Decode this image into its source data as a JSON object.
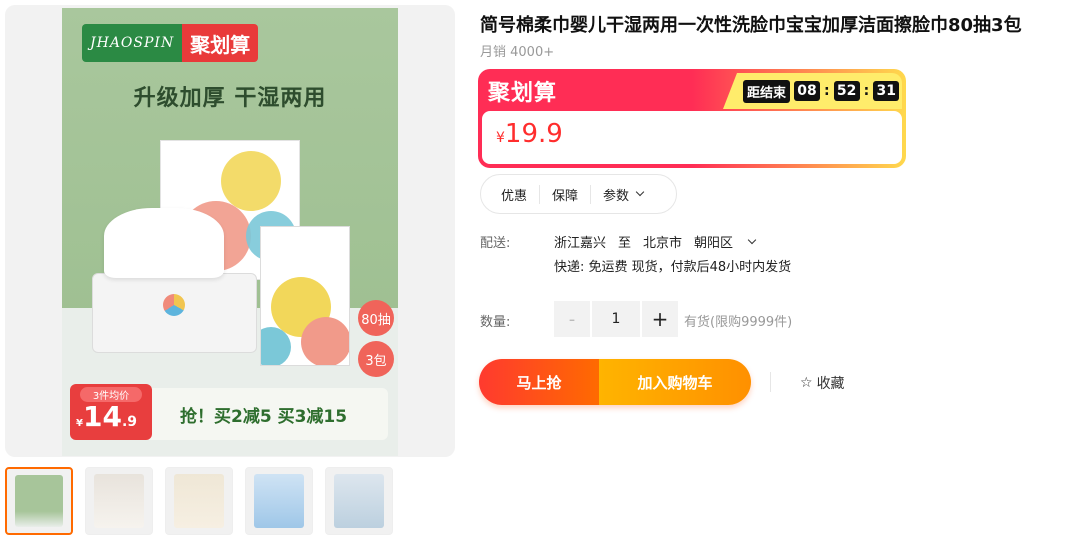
{
  "gallery": {
    "brand_logo": "JHAOSPIN",
    "brand_tag": "聚划算",
    "slogan": "升级加厚 干湿两用",
    "badge_count": "80抽",
    "badge_packs": "3包",
    "promo_label": "3件均价",
    "promo_currency": "¥",
    "promo_price_int": "14",
    "promo_price_dec": ".9",
    "promo_text": "抢！买2减5 买3减15",
    "thumbnails": [
      "thumb-1",
      "thumb-2",
      "thumb-3",
      "thumb-4",
      "thumb-5"
    ]
  },
  "product": {
    "title": "简号棉柔巾婴儿干湿两用一次性洗脸巾宝宝加厚洁面擦脸巾80抽3包",
    "sales": "月销 4000+"
  },
  "promo": {
    "label": "聚划算",
    "countdown_label": "距结束",
    "hours": "08",
    "minutes": "52",
    "seconds": "31",
    "currency": "¥",
    "price": "19.9"
  },
  "service_tabs": [
    "优惠",
    "保障",
    "参数"
  ],
  "shipping": {
    "label": "配送:",
    "from": "浙江嘉兴",
    "to_word": "至",
    "city": "北京市",
    "district": "朝阳区",
    "detail": "快递: 免运费  现货，付款后48小时内发货"
  },
  "quantity": {
    "label": "数量:",
    "minus": "-",
    "value": "1",
    "plus": "+",
    "stock": "有货(限购9999件)"
  },
  "actions": {
    "buy_now": "马上抢",
    "add_cart": "加入购物车",
    "collect": "收藏",
    "collect_icon": "☆"
  },
  "colors": {
    "accent_red": "#ff2d55",
    "accent_orange": "#ff6a00",
    "accent_yellow": "#ffd94d"
  }
}
